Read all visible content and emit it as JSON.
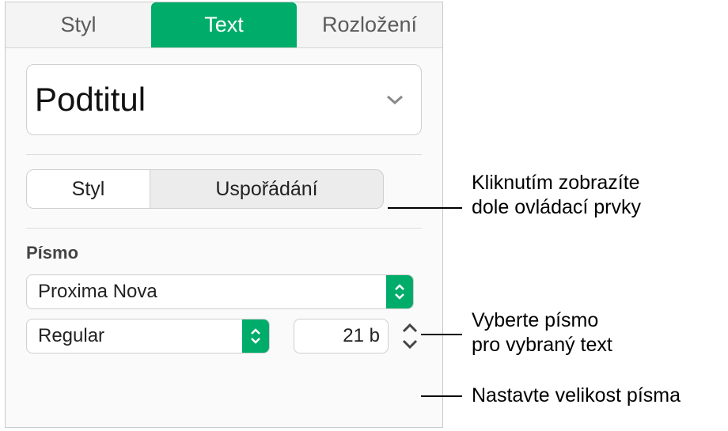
{
  "topTabs": {
    "styl": "Styl",
    "text": "Text",
    "rozlozeni": "Rozložení"
  },
  "paragraphStyle": {
    "current": "Podtitul"
  },
  "segmented": {
    "styl": "Styl",
    "usporadani": "Uspořádání"
  },
  "font": {
    "sectionLabel": "Písmo",
    "family": "Proxima Nova",
    "weight": "Regular",
    "sizeDisplay": "21 b"
  },
  "callouts": {
    "segmented": "Kliknutím zobrazíte\ndole ovládací prvky",
    "fontFamily": "Vyberte písmo\npro vybraný text",
    "fontSize": "Nastavte velikost písma"
  }
}
